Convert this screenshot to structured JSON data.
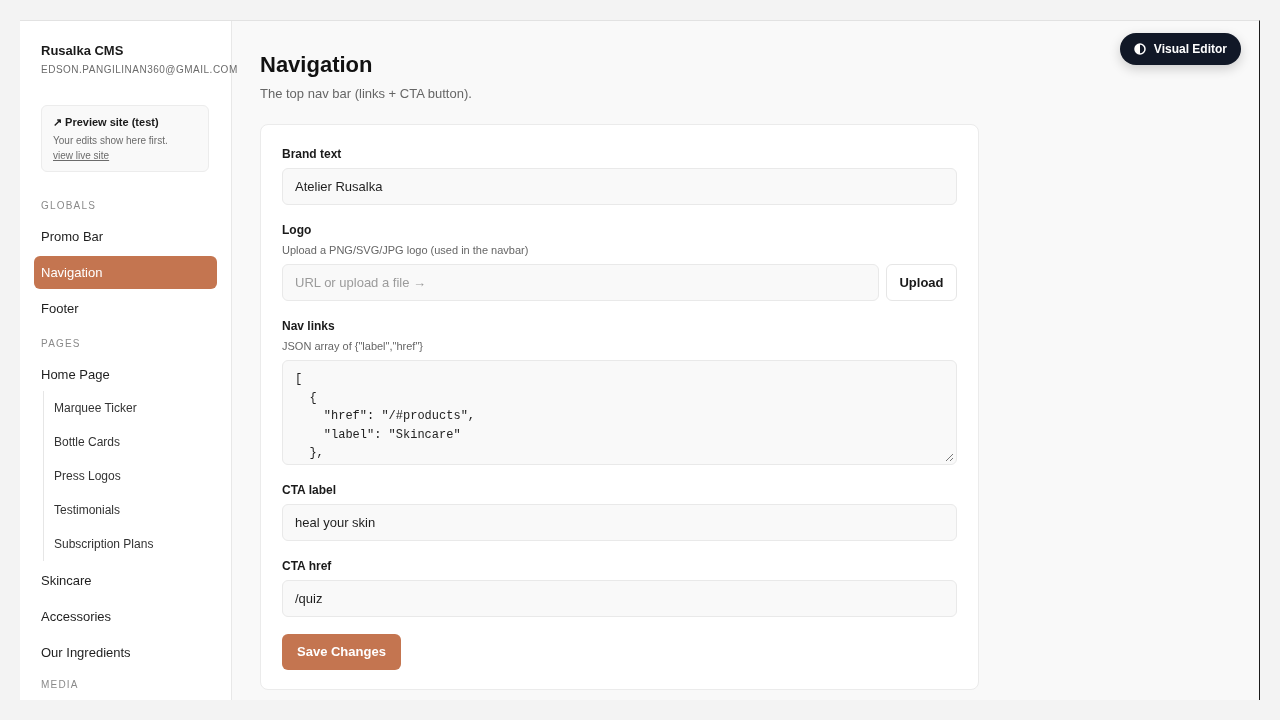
{
  "sidebar": {
    "title": "Rusalka CMS",
    "email": "EDSON.PANGILINAN360@GMAIL.COM",
    "preview_card": {
      "title": "↗ Preview site (test)",
      "text": "Your edits show here first.",
      "link": "view live site"
    },
    "sections": [
      {
        "heading": "GLOBALS",
        "items": [
          {
            "label": "Promo Bar",
            "selected": false
          },
          {
            "label": "Navigation",
            "selected": true
          },
          {
            "label": "Footer",
            "selected": false
          }
        ]
      },
      {
        "heading": "PAGES",
        "items": [
          {
            "label": "Home Page",
            "selected": false,
            "children": [
              {
                "label": "Marquee Ticker",
                "selected": false
              },
              {
                "label": "Bottle Cards",
                "selected": false
              },
              {
                "label": "Press Logos",
                "selected": false
              },
              {
                "label": "Testimonials",
                "selected": false
              },
              {
                "label": "Subscription Plans",
                "selected": false
              }
            ]
          },
          {
            "label": "Skincare",
            "selected": false
          },
          {
            "label": "Accessories",
            "selected": false
          },
          {
            "label": "Our Ingredients",
            "selected": false
          }
        ]
      },
      {
        "heading": "MEDIA"
      }
    ]
  },
  "visual_editor_button": {
    "label": "Visual Editor"
  },
  "page": {
    "title": "Navigation",
    "subtitle": "The top nav bar (links + CTA button)."
  },
  "form": {
    "fields": [
      {
        "kind": "text",
        "label": "Brand text",
        "value": "Atelier Rusalka"
      },
      {
        "kind": "upload",
        "label": "Logo",
        "hint": "Upload a PNG/SVG/JPG logo (used in the navbar)",
        "placeholder": "URL or upload a file →",
        "button": "Upload"
      },
      {
        "kind": "code",
        "label": "Nav links",
        "hint": "JSON array of {\"label\",\"href\"}",
        "value": "[\n  {\n    \"href\": \"/#products\",\n    \"label\": \"Skincare\"\n  },"
      },
      {
        "kind": "text",
        "label": "CTA label",
        "value": "heal your skin"
      },
      {
        "kind": "text",
        "label": "CTA href",
        "value": "/quiz"
      }
    ],
    "submit": "Save Changes"
  }
}
